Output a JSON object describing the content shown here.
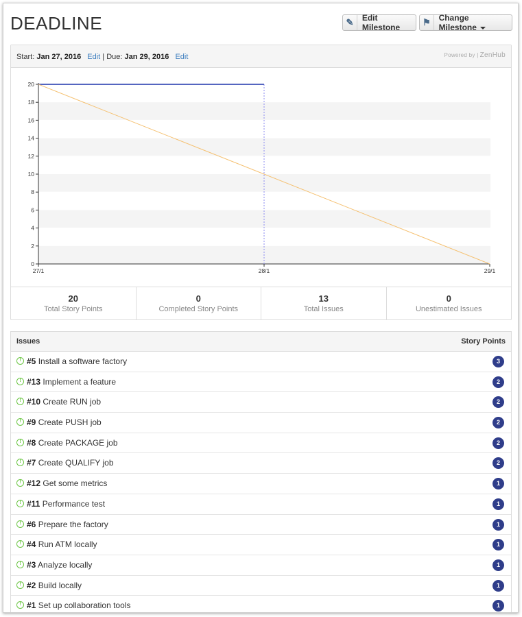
{
  "header": {
    "title": "DEADLINE",
    "edit_label": "Edit Milestone",
    "edit_icon": "pencil-icon",
    "change_label": "Change Milestone",
    "change_icon": "signpost-icon"
  },
  "milestone": {
    "start_label": "Start:",
    "start_date": "Jan 27, 2016",
    "edit_link": "Edit",
    "separator": "|",
    "due_label": "Due:",
    "due_date": "Jan 29, 2016",
    "powered_by": "Powered by |",
    "brand": "ZenHub"
  },
  "chart_data": {
    "type": "line",
    "x_ticks": [
      "27/1",
      "28/1",
      "29/1"
    ],
    "ylim": [
      0,
      20
    ],
    "y_ticks": [
      0,
      2,
      4,
      6,
      8,
      10,
      12,
      14,
      16,
      18,
      20
    ],
    "grid": "alternating horizontal bands",
    "series": [
      {
        "x": [
          "27/1",
          "28/1"
        ],
        "values": [
          20,
          20
        ],
        "color": "#5566c0"
      },
      {
        "x": [
          "27/1",
          "29/1"
        ],
        "values": [
          20,
          0
        ],
        "color": "#f5c070"
      }
    ],
    "today_marker": "28/1"
  },
  "stats": [
    {
      "value": "20",
      "label": "Total Story Points"
    },
    {
      "value": "0",
      "label": "Completed Story Points"
    },
    {
      "value": "13",
      "label": "Total Issues"
    },
    {
      "value": "0",
      "label": "Unestimated Issues"
    }
  ],
  "issues": {
    "head_left": "Issues",
    "head_right": "Story Points",
    "rows": [
      {
        "num": "#5",
        "title": "Install a software factory",
        "points": "3"
      },
      {
        "num": "#13",
        "title": "Implement a feature",
        "points": "2"
      },
      {
        "num": "#10",
        "title": "Create RUN job",
        "points": "2"
      },
      {
        "num": "#9",
        "title": "Create PUSH job",
        "points": "2"
      },
      {
        "num": "#8",
        "title": "Create PACKAGE job",
        "points": "2"
      },
      {
        "num": "#7",
        "title": "Create QUALIFY job",
        "points": "2"
      },
      {
        "num": "#12",
        "title": "Get some metrics",
        "points": "1"
      },
      {
        "num": "#11",
        "title": "Performance test",
        "points": "1"
      },
      {
        "num": "#6",
        "title": "Prepare the factory",
        "points": "1"
      },
      {
        "num": "#4",
        "title": "Run ATM locally",
        "points": "1"
      },
      {
        "num": "#3",
        "title": "Analyze locally",
        "points": "1"
      },
      {
        "num": "#2",
        "title": "Build locally",
        "points": "1"
      },
      {
        "num": "#1",
        "title": "Set up collaboration tools",
        "points": "1"
      }
    ]
  }
}
